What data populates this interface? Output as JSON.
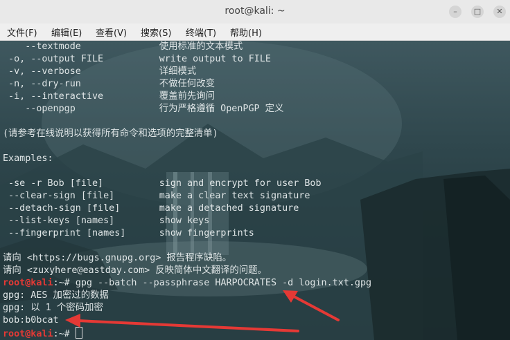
{
  "window": {
    "title": "root@kali: ~"
  },
  "window_controls": {
    "minimize": "–",
    "maximize": "□",
    "close": "✕"
  },
  "menu": {
    "items": [
      "文件(F)",
      "编辑(E)",
      "查看(V)",
      "搜索(S)",
      "终端(T)",
      "帮助(H)"
    ]
  },
  "terminal": {
    "lines": [
      "    --textmode              使用标准的文本模式",
      " -o, --output FILE          write output to FILE",
      " -v, --verbose              详细模式",
      " -n, --dry-run              不做任何改变",
      " -i, --interactive          覆盖前先询问",
      "    --openpgp               行为严格遵循 OpenPGP 定义",
      "",
      "(请参考在线说明以获得所有命令和选项的完整清单)",
      "",
      "Examples:",
      "",
      " -se -r Bob [file]          sign and encrypt for user Bob",
      " --clear-sign [file]        make a clear text signature",
      " --detach-sign [file]       make a detached signature",
      " --list-keys [names]        show keys",
      " --fingerprint [names]      show fingerprints",
      "",
      "请向 <https://bugs.gnupg.org> 报告程序缺陷。",
      "请向 <zuxyhere@eastday.com> 反映简体中文翻译的问题。"
    ],
    "prompt_user": "root@kali",
    "prompt_suffix": ":~# ",
    "command": "gpg --batch --passphrase HARPOCRATES -d login.txt.gpg",
    "output": [
      "gpg: AES 加密过的数据",
      "gpg: 以 1 个密码加密",
      "bob:b0bcat"
    ],
    "final_prompt_user": "root@kali",
    "final_prompt_suffix": ":~# "
  },
  "annotation_color": "#e53935"
}
